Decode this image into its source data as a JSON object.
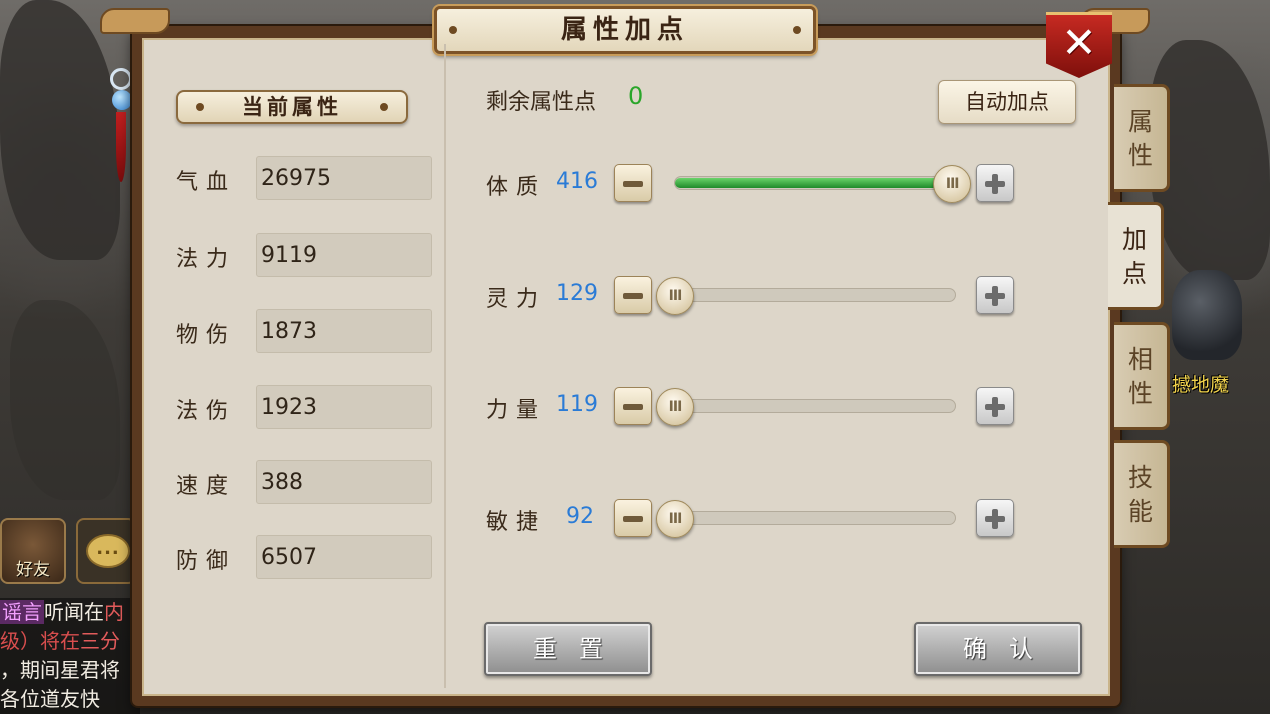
{
  "dialog": {
    "title": "属性加点",
    "close_icon": "close-icon"
  },
  "current_attributes": {
    "header": "当前属性",
    "stats": [
      {
        "label": "气血",
        "value": "26975"
      },
      {
        "label": "法力",
        "value": "9119"
      },
      {
        "label": "物伤",
        "value": "1873"
      },
      {
        "label": "法伤",
        "value": "1923"
      },
      {
        "label": "速度",
        "value": "388"
      },
      {
        "label": "防御",
        "value": "6507"
      }
    ]
  },
  "allocation": {
    "remaining_label": "剩余属性点",
    "remaining_value": "0",
    "auto_button": "自动加点",
    "attributes": [
      {
        "label": "体质",
        "value": "416",
        "level": 0.99
      },
      {
        "label": "灵力",
        "value": "129",
        "level": 0.0
      },
      {
        "label": "力量",
        "value": "119",
        "level": 0.0
      },
      {
        "label": "敏捷",
        "value": "92",
        "level": 0.0
      }
    ],
    "reset_button": "重置",
    "confirm_button": "确认"
  },
  "side_tabs": [
    {
      "label": "属性",
      "active": false
    },
    {
      "label": "加点",
      "active": true
    },
    {
      "label": "相性",
      "active": false
    },
    {
      "label": "技能",
      "active": false
    }
  ],
  "background": {
    "monster_name": "撼地魔",
    "friend_button": "好友",
    "chat_lines": [
      {
        "tag": "谣言",
        "text": "听闻在",
        "hl": "内"
      },
      {
        "text": "级）将在",
        "hl": "三分"
      },
      {
        "text": "，期间星君将"
      },
      {
        "text": "各位道友快"
      }
    ]
  },
  "colors": {
    "remaining_value": "#2aa62a",
    "attribute_value": "#2a7bd6",
    "slider_fill": "#2aa62a",
    "close_button": "#c62a22"
  }
}
